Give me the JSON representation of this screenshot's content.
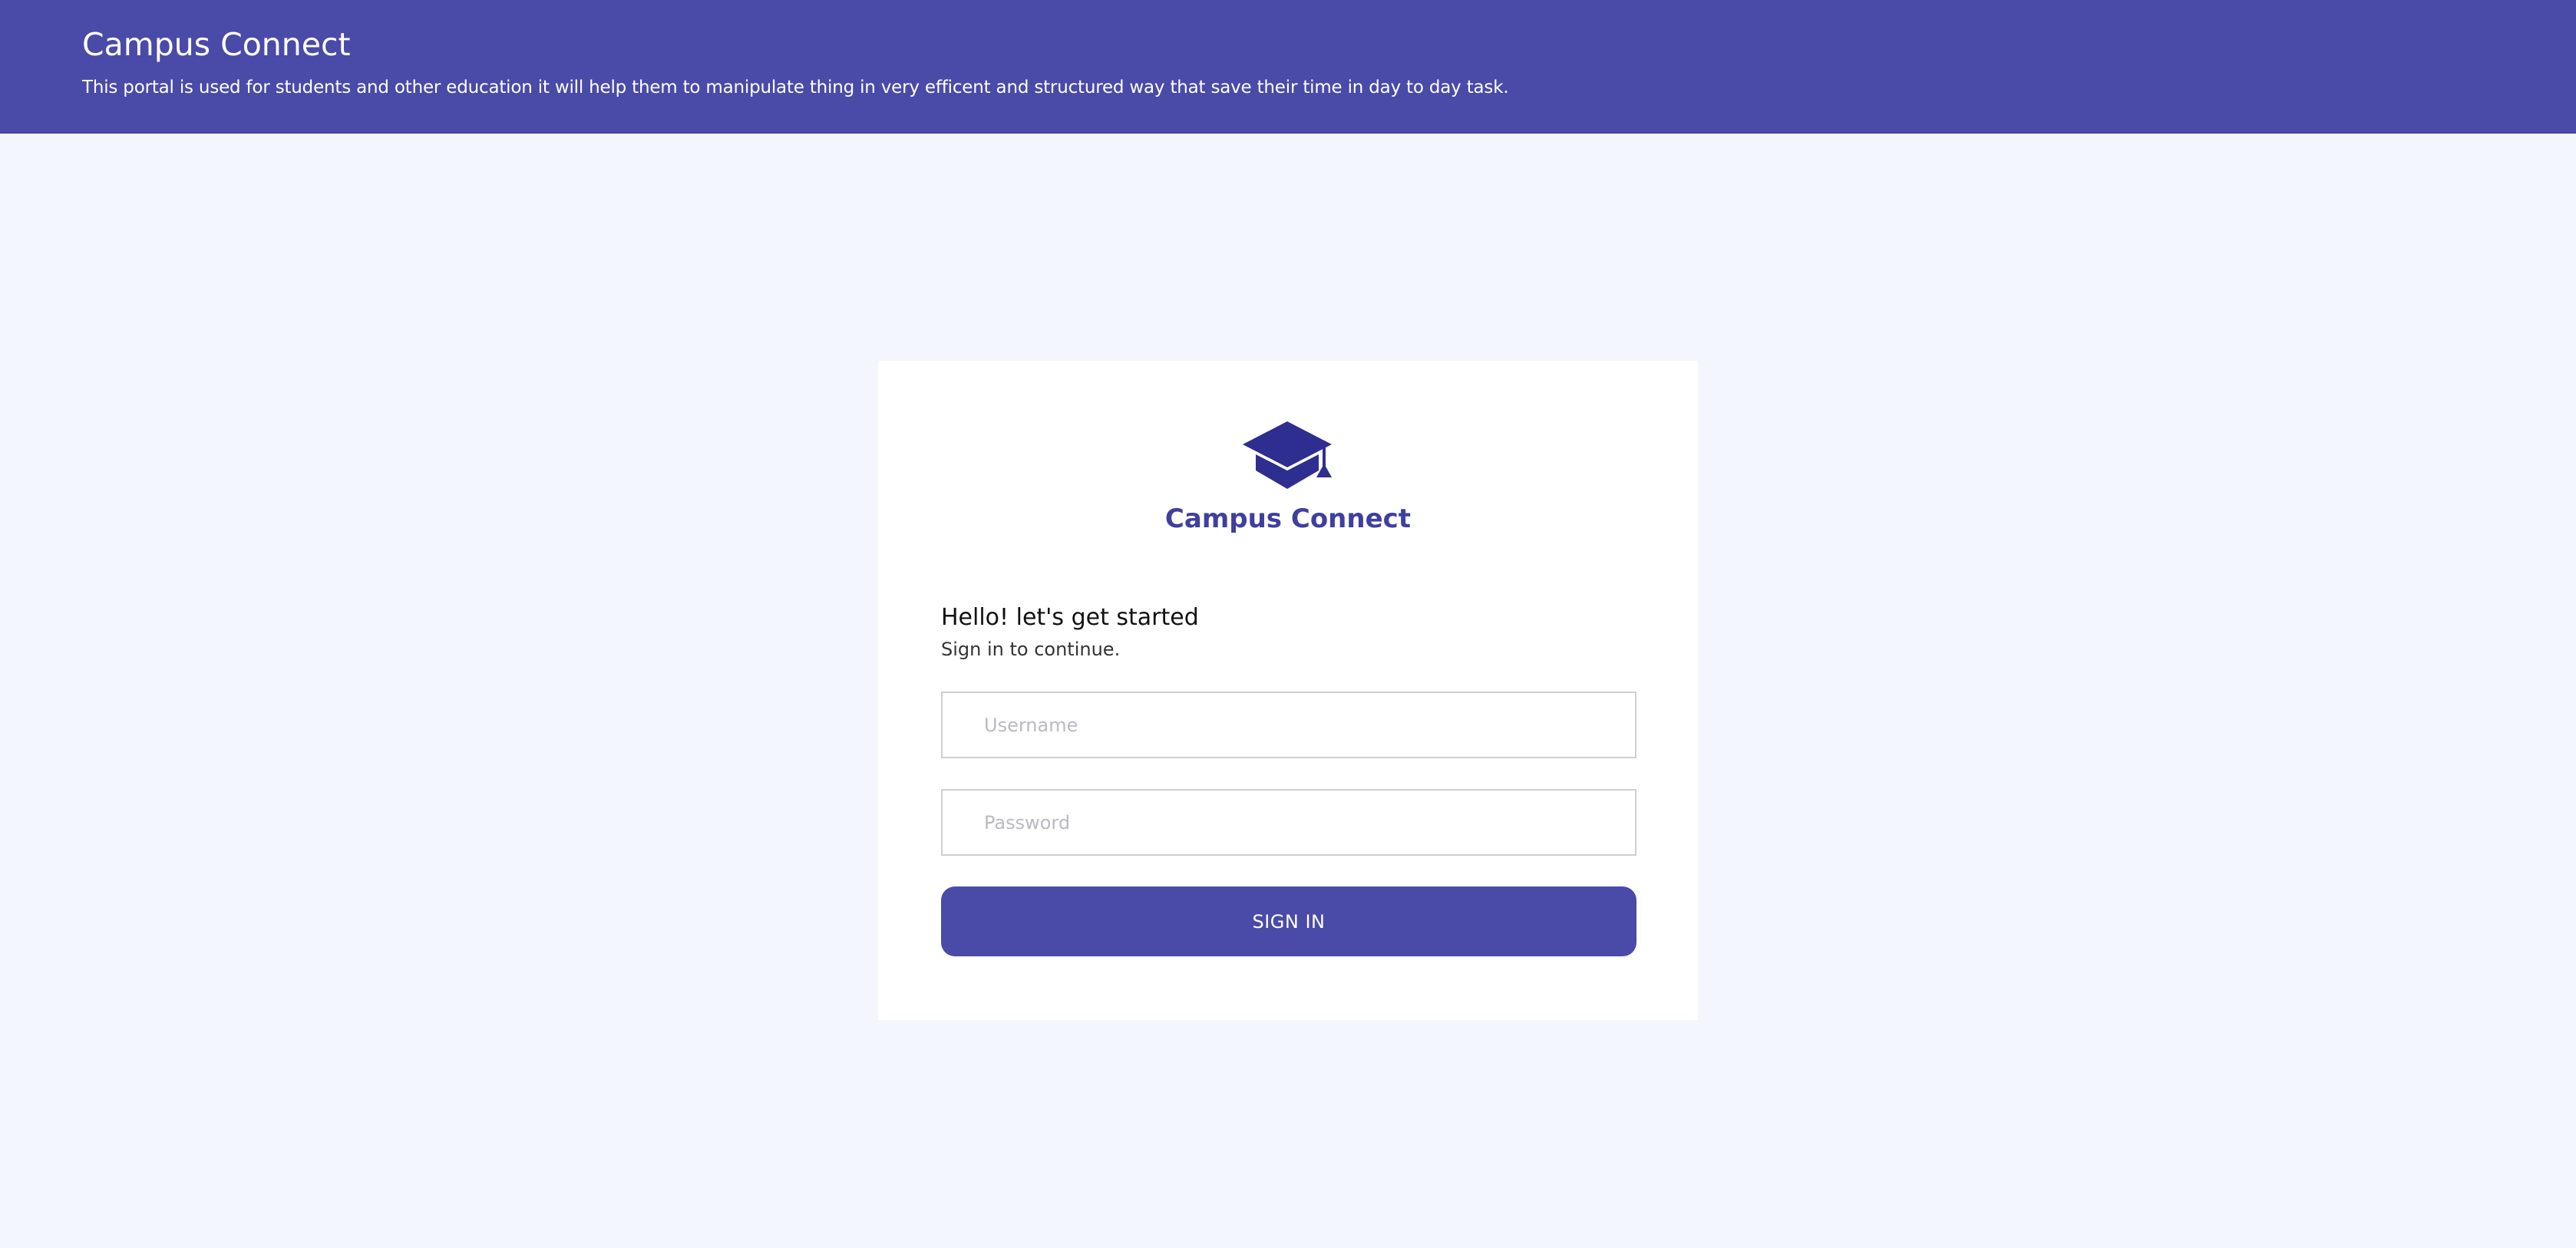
{
  "header": {
    "title": "Campus Connect",
    "description": "This portal is used for students and other education it will help them to manipulate thing in very efficent and structured way that save their time in day to day task."
  },
  "login_card": {
    "logo_icon": "graduation-cap-icon",
    "brand_name": "Campus Connect",
    "greeting": "Hello! let's get started",
    "subtitle": "Sign in to continue.",
    "username": {
      "placeholder": "Username",
      "value": ""
    },
    "password": {
      "placeholder": "Password",
      "value": ""
    },
    "signin_label": "SIGN IN"
  },
  "colors": {
    "header_bg": "#4a4aa8",
    "page_bg": "#f3f6fd",
    "brand_text": "#3f3f9f",
    "logo": "#2e2e90",
    "button_bg": "#4a4aa8"
  }
}
